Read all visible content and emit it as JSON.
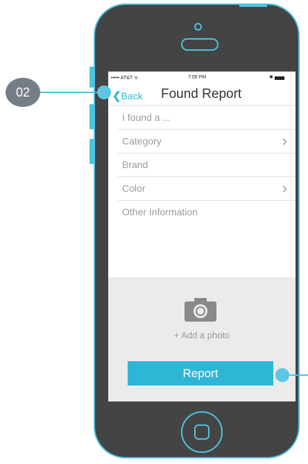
{
  "status_bar": {
    "carrier": "••••• AT&T ᯤ",
    "time": "7:05 PM",
    "bluetooth": "✱"
  },
  "nav": {
    "back_label": "Back",
    "back_chevron": "❮",
    "title": "Found Report"
  },
  "form": {
    "rows": [
      {
        "label": "I found a ..."
      },
      {
        "label": "Category",
        "arrow": "›"
      },
      {
        "label": "Brand"
      },
      {
        "label": "Color",
        "arrow": "›"
      },
      {
        "label": "Other Information"
      }
    ]
  },
  "photo": {
    "add_label": "+ Add a photo",
    "icon": "camera-icon"
  },
  "report": {
    "label": "Report"
  },
  "callouts": {
    "badge": "02"
  },
  "colors": {
    "accent": "#2fb6d6",
    "phone_body": "#444444",
    "outline": "#4ec3e0"
  }
}
